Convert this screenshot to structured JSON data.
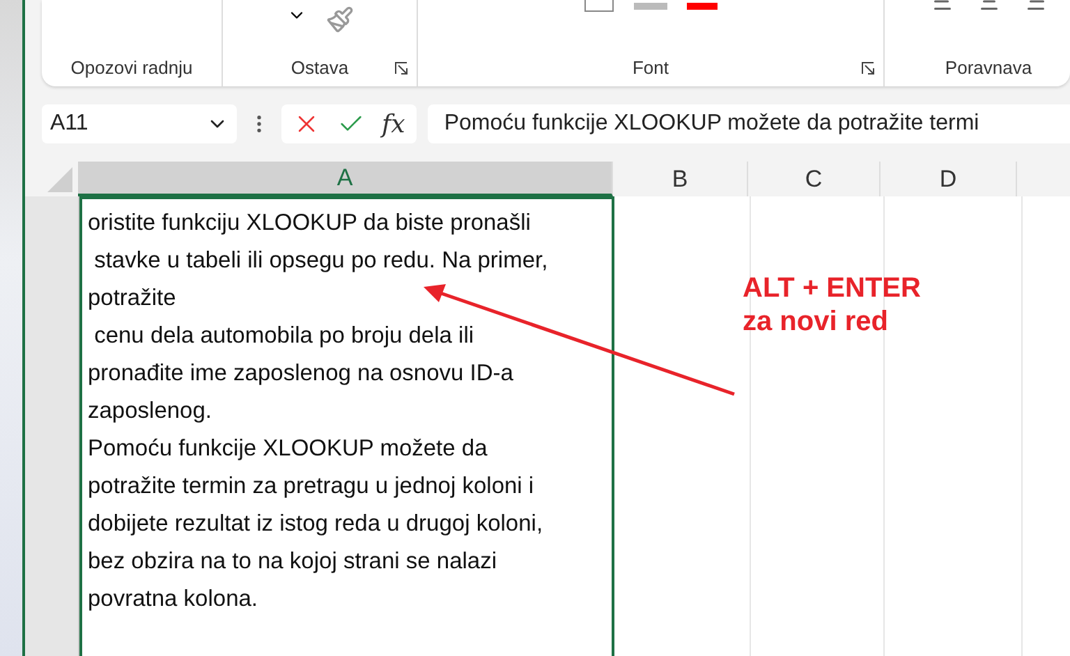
{
  "ribbon": {
    "groups": [
      {
        "label": "Opozovi radnju",
        "launcher": false
      },
      {
        "label": "Ostava",
        "launcher": true
      },
      {
        "label": "Font",
        "launcher": true
      },
      {
        "label": "Poravnava",
        "launcher": false
      }
    ]
  },
  "formula_bar": {
    "name_box": "A11",
    "function_button": "fx",
    "formula": "Pomoću funkcije XLOOKUP možete da potražite termi"
  },
  "columns": [
    {
      "label": "A",
      "selected": true
    },
    {
      "label": "B",
      "selected": false
    },
    {
      "label": "C",
      "selected": false
    },
    {
      "label": "D",
      "selected": false
    }
  ],
  "cell": {
    "lines": [
      "oristite funkciju XLOOKUP da biste pronašli",
      " stavke u tabeli ili opsegu po redu. Na primer,",
      "potražite",
      " cenu dela automobila po broju dela ili",
      "pronađite ime zaposlenog na osnovu ID-a",
      "zaposlenog.",
      "Pomoću funkcije XLOOKUP možete da",
      "potražite termin za pretragu u jednoj koloni i",
      "dobijete rezultat iz istog reda u drugoj koloni,",
      "bez obzira na to na kojoj strani se nalazi",
      "povratna kolona."
    ]
  },
  "annotation": {
    "lines": [
      "ALT + ENTER",
      "za novi red"
    ]
  }
}
